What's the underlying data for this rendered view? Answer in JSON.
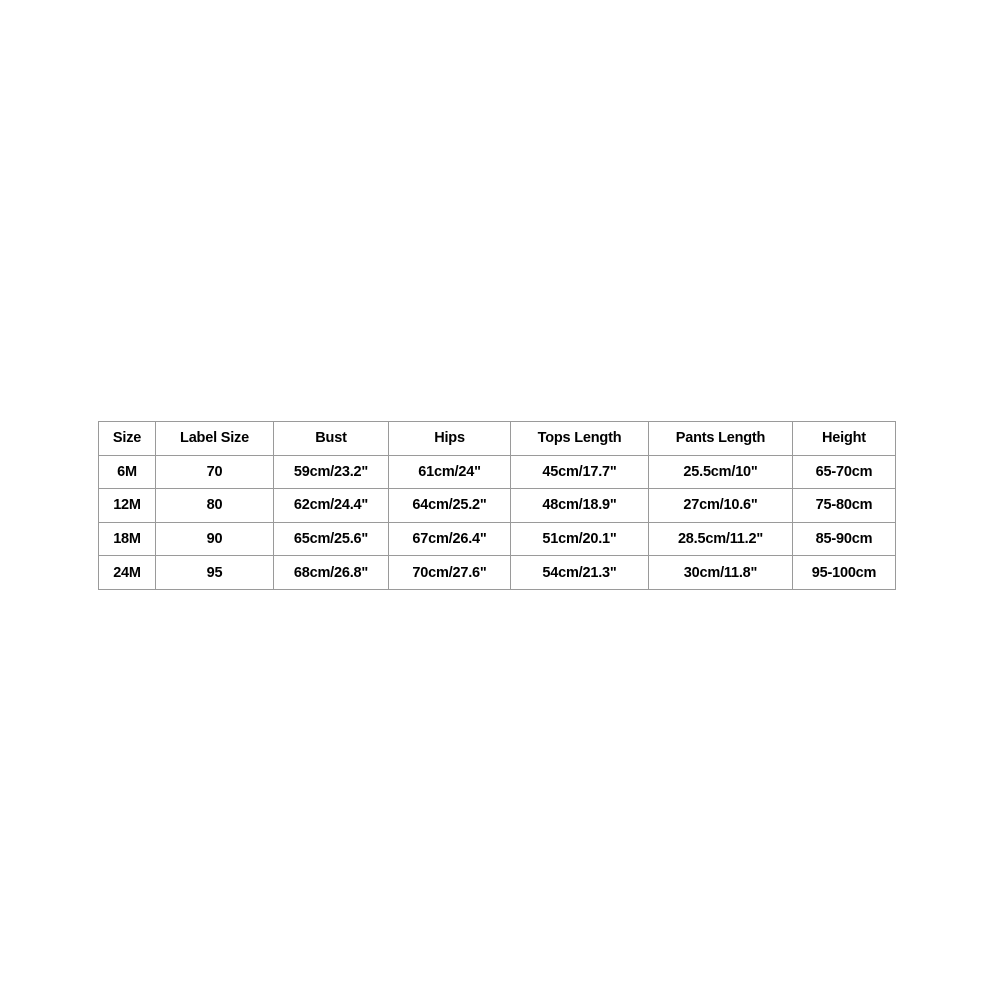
{
  "page": {
    "background_color": "#ffffff",
    "text_color": "#000000",
    "border_color": "#9a9a9a"
  },
  "size_chart": {
    "columns": [
      "Size",
      "Label Size",
      "Bust",
      "Hips",
      "Tops Length",
      "Pants Length",
      "Height"
    ],
    "rows": [
      {
        "size": "6M",
        "label_size": "70",
        "bust": "59cm/23.2\"",
        "hips": "61cm/24\"",
        "tops_length": "45cm/17.7\"",
        "pants_length": "25.5cm/10\"",
        "height": "65-70cm"
      },
      {
        "size": "12M",
        "label_size": "80",
        "bust": "62cm/24.4\"",
        "hips": "64cm/25.2\"",
        "tops_length": "48cm/18.9\"",
        "pants_length": "27cm/10.6\"",
        "height": "75-80cm"
      },
      {
        "size": "18M",
        "label_size": "90",
        "bust": "65cm/25.6\"",
        "hips": "67cm/26.4\"",
        "tops_length": "51cm/20.1\"",
        "pants_length": "28.5cm/11.2\"",
        "height": "85-90cm"
      },
      {
        "size": "24M",
        "label_size": "95",
        "bust": "68cm/26.8\"",
        "hips": "70cm/27.6\"",
        "tops_length": "54cm/21.3\"",
        "pants_length": "30cm/11.8\"",
        "height": "95-100cm"
      }
    ]
  }
}
